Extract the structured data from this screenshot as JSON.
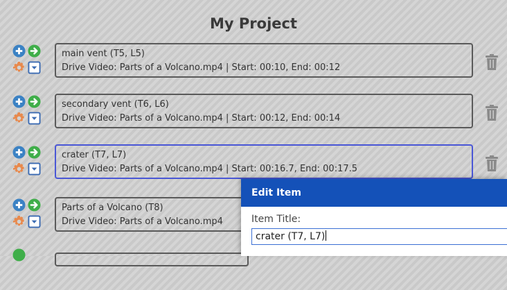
{
  "project": {
    "title": "My Project"
  },
  "items": [
    {
      "title": "main vent (T5, L5)",
      "detail": "Drive Video: Parts of a Volcano.mp4 | Start: 00:10, End: 00:12"
    },
    {
      "title": "secondary vent (T6, L6)",
      "detail": "Drive Video: Parts of a Volcano.mp4 | Start: 00:12, End: 00:14"
    },
    {
      "title": "crater (T7, L7)",
      "detail": "Drive Video: Parts of a Volcano.mp4 | Start: 00:16.7, End: 00:17.5"
    },
    {
      "title": "Parts of a Volcano (T8)",
      "detail": "Drive Video: Parts of a Volcano.mp4"
    }
  ],
  "edit_popup": {
    "header": "Edit Item",
    "field_label": "Item Title:",
    "field_value": "crater (T7, L7)"
  },
  "colors": {
    "add_icon": "#3b82c4",
    "go_icon": "#3fae49",
    "gear_icon": "#e8894c",
    "dropdown_icon": "#3b6bb3",
    "selected_border": "#4a57d6",
    "popup_header": "#1451b8"
  },
  "icons": [
    "plus-circle-icon",
    "arrow-right-circle-icon",
    "gear-icon",
    "dropdown-icon",
    "trash-icon"
  ]
}
